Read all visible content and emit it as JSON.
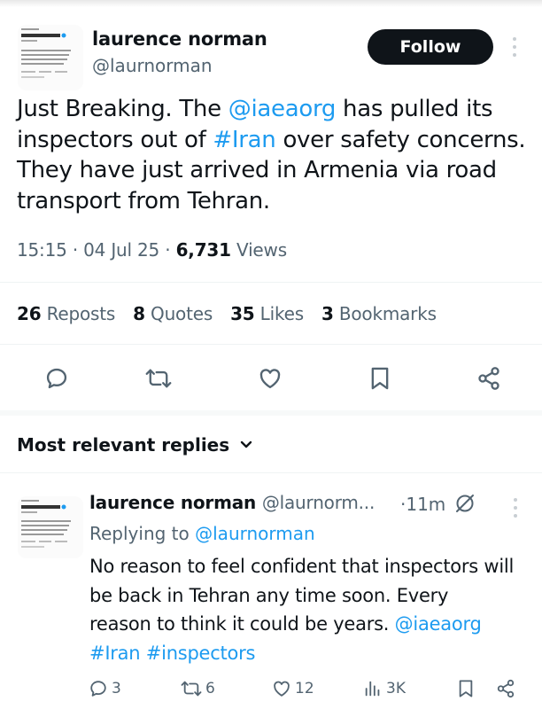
{
  "main_tweet": {
    "author_name": "laurence norman",
    "author_handle": "@laurnorman",
    "follow_label": "Follow",
    "text_parts": {
      "t1": "Just Breaking. The ",
      "mention": "@iaeaorg",
      "t2": " has pulled its inspectors out of ",
      "hashtag": "#Iran",
      "t3": " over safety concerns. They have just arrived in Armenia via road transport from Tehran."
    },
    "time": "15:15",
    "date": "04 Jul 25",
    "views_count": "6,731",
    "views_label": "Views",
    "stats": {
      "reposts_count": "26",
      "reposts_label": "Reposts",
      "quotes_count": "8",
      "quotes_label": "Quotes",
      "likes_count": "35",
      "likes_label": "Likes",
      "bookmarks_count": "3",
      "bookmarks_label": "Bookmarks"
    },
    "actions": [
      "reply-icon",
      "repost-icon",
      "like-icon",
      "bookmark-icon",
      "share-icon"
    ]
  },
  "replies_header": "Most relevant replies",
  "reply": {
    "author_name": "laurence norman",
    "author_handle": "@laurnorm...",
    "separator": "·",
    "time": "11m",
    "replying_prefix": "Replying to ",
    "replying_handle": "@laurnorman",
    "text": "No reason to feel confident that inspectors will be back in Tehran any time soon. Every reason to think it could be years. ",
    "mention": "@iaeaorg",
    "hashtags": "#Iran #inspectors",
    "counts": {
      "replies": "3",
      "reposts": "6",
      "likes": "12",
      "views": "3K"
    }
  },
  "colors": {
    "link": "#1d9bf0",
    "text": "#0f1419",
    "secondary": "#536471",
    "follow_bg": "#0f1419"
  }
}
